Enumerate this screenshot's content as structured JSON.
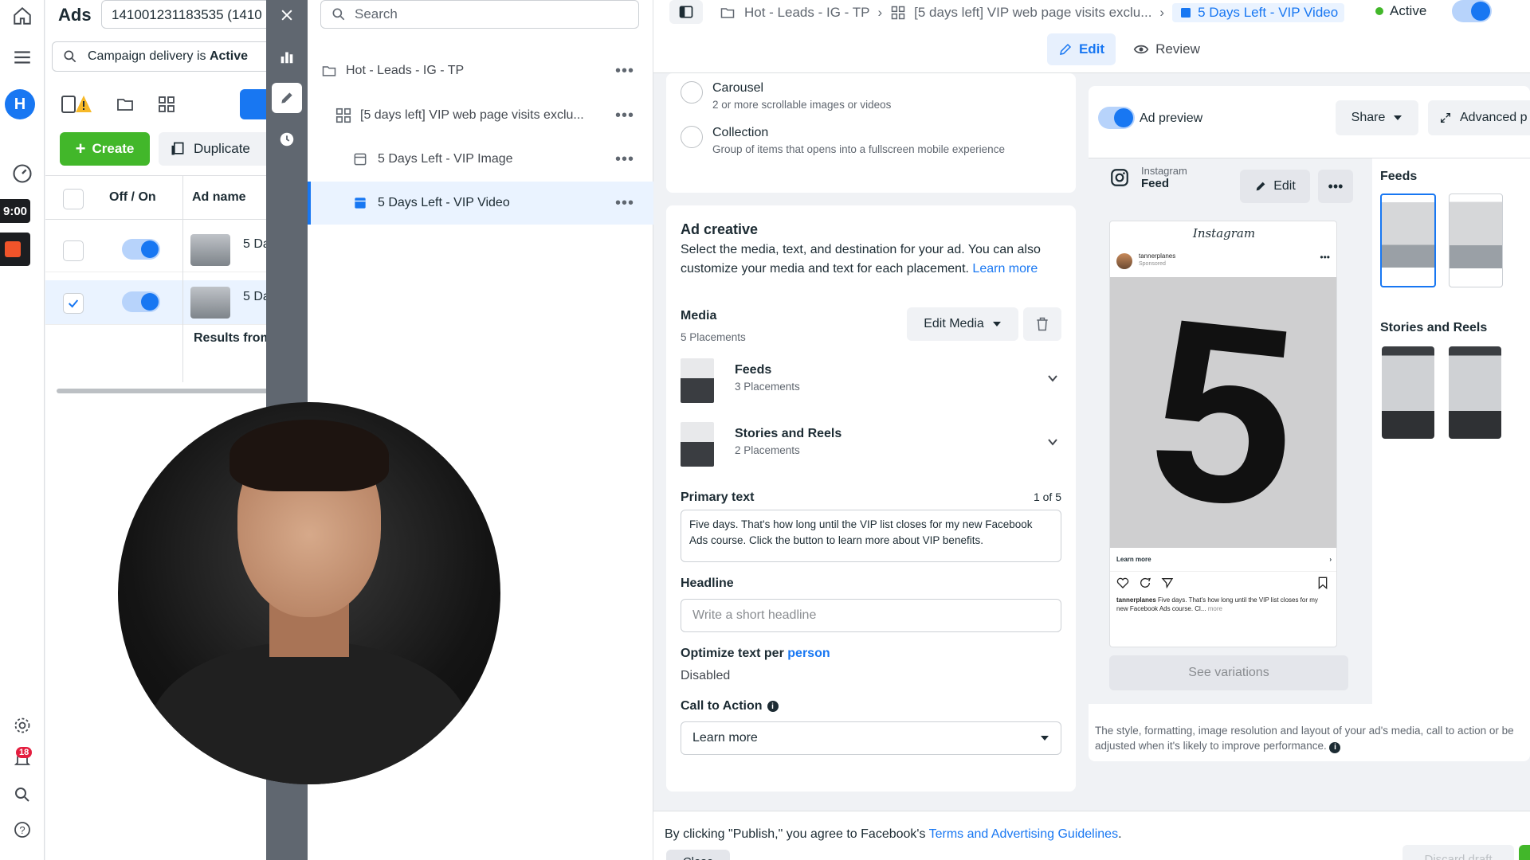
{
  "left_rail": {
    "avatar_letter": "H",
    "timer": "9:00",
    "notifications_count": "18"
  },
  "ads_panel": {
    "title": "Ads",
    "campaign_id": "141001231183535 (1410",
    "filter_prefix": "Campaign delivery is",
    "filter_value": "Active",
    "create_label": "Create",
    "duplicate_label": "Duplicate",
    "col_off_on": "Off / On",
    "col_ad_name": "Ad name",
    "rows": [
      {
        "name": "5 Da",
        "on": true,
        "checked": false
      },
      {
        "name": "5 Da",
        "on": true,
        "checked": true
      }
    ],
    "results_from": "Results from"
  },
  "tree": {
    "search_placeholder": "Search",
    "items": [
      {
        "label": "Hot - Leads - IG - TP"
      },
      {
        "label": "[5 days left] VIP web page visits exclu..."
      },
      {
        "label": "5 Days Left - VIP Image"
      },
      {
        "label": "5 Days Left - VIP Video"
      }
    ]
  },
  "editor_top": {
    "breadcrumb_campaign": "Hot - Leads - IG - TP",
    "breadcrumb_adset": "[5 days left] VIP web page visits exclu...",
    "breadcrumb_ad": "5 Days Left - VIP Video",
    "status": "Active",
    "tab_edit": "Edit",
    "tab_review": "Review"
  },
  "format": {
    "carousel_title": "Carousel",
    "carousel_desc": "2 or more scrollable images or videos",
    "collection_title": "Collection",
    "collection_desc": "Group of items that opens into a fullscreen mobile experience"
  },
  "creative": {
    "title": "Ad creative",
    "description": "Select the media, text, and destination for your ad. You can also customize your media and text for each placement.",
    "learn_more": "Learn more",
    "media_label": "Media",
    "media_sub": "5 Placements",
    "edit_media": "Edit Media",
    "media_rows": [
      {
        "title": "Feeds",
        "sub": "3 Placements"
      },
      {
        "title": "Stories and Reels",
        "sub": "2 Placements"
      }
    ],
    "primary_text_label": "Primary text",
    "primary_text_counter": "1 of 5",
    "primary_text_value": "Five days. That's how long until the VIP list closes for my new Facebook Ads course. Click the button to learn more about VIP benefits.",
    "headline_label": "Headline",
    "headline_placeholder": "Write a short headline",
    "optimize_prefix": "Optimize text per",
    "optimize_link": "person",
    "optimize_value": "Disabled",
    "cta_label": "Call to Action",
    "cta_value": "Learn more"
  },
  "preview": {
    "toggle_label": "Ad preview",
    "share": "Share",
    "advanced": "Advanced p",
    "platform": "Instagram",
    "placement": "Feed",
    "edit": "Edit",
    "ig_logo": "Instagram",
    "post_user": "tannerplanes",
    "post_sponsored": "Sponsored",
    "big_number": "5",
    "post_learn_more": "Learn more",
    "post_caption_user": "tannerplanes",
    "post_caption": "Five days. That's how long until the VIP list closes for my new Facebook Ads course. Cl...",
    "post_caption_more": "more",
    "see_variations": "See variations",
    "feeds_title": "Feeds",
    "stories_title": "Stories and Reels",
    "note": "The style, formatting, image resolution and layout of your ad's media, call to action or be adjusted when it's likely to improve performance."
  },
  "footer": {
    "text_prefix": "By clicking \"Publish,\" you agree to Facebook's",
    "terms_link": "Terms and Advertising Guidelines",
    "text_suffix": ".",
    "close": "Close",
    "discard": "Discard draft"
  },
  "colors": {
    "brand_blue": "#1877f2",
    "create_green": "#42b72a",
    "status_green": "#42b72a",
    "badge_red": "#e41e3f"
  }
}
